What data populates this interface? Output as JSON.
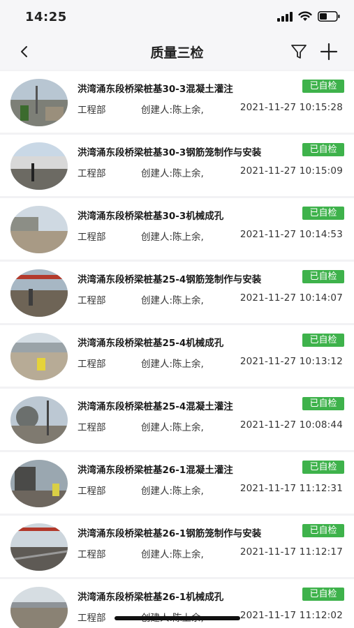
{
  "status": {
    "time": "14:25"
  },
  "nav": {
    "title": "质量三检",
    "back_icon": "back-chevron-icon",
    "filter_icon": "filter-icon",
    "add_icon": "plus-icon"
  },
  "colors": {
    "badge": "#3eb24b",
    "background": "#f2f2f4"
  },
  "items": [
    {
      "title": "洪湾涌东段桥梁桩基30-3混凝土灌注",
      "status": "已自检",
      "dept": "工程部",
      "creator": "创建人:陈上余,",
      "time": "2021-11-27 10:15:28"
    },
    {
      "title": "洪湾涌东段桥梁桩基30-3钢筋笼制作与安装",
      "status": "已自检",
      "dept": "工程部",
      "creator": "创建人:陈上余,",
      "time": "2021-11-27 10:15:09"
    },
    {
      "title": "洪湾涌东段桥梁桩基30-3机械成孔",
      "status": "已自检",
      "dept": "工程部",
      "creator": "创建人:陈上余,",
      "time": "2021-11-27 10:14:53"
    },
    {
      "title": "洪湾涌东段桥梁桩基25-4钢筋笼制作与安装",
      "status": "已自检",
      "dept": "工程部",
      "creator": "创建人:陈上余,",
      "time": "2021-11-27 10:14:07"
    },
    {
      "title": "洪湾涌东段桥梁桩基25-4机械成孔",
      "status": "已自检",
      "dept": "工程部",
      "creator": "创建人:陈上余,",
      "time": "2021-11-27 10:13:12"
    },
    {
      "title": "洪湾涌东段桥梁桩基25-4混凝土灌注",
      "status": "已自检",
      "dept": "工程部",
      "creator": "创建人:陈上余,",
      "time": "2021-11-27 10:08:44"
    },
    {
      "title": "洪湾涌东段桥梁桩基26-1混凝土灌注",
      "status": "已自检",
      "dept": "工程部",
      "creator": "创建人:陈上余,",
      "time": "2021-11-17 11:12:31"
    },
    {
      "title": "洪湾涌东段桥梁桩基26-1钢筋笼制作与安装",
      "status": "已自检",
      "dept": "工程部",
      "creator": "创建人:陈上余,",
      "time": "2021-11-17 11:12:17"
    },
    {
      "title": "洪湾涌东段桥梁桩基26-1机械成孔",
      "status": "已自检",
      "dept": "工程部",
      "creator": "创建人:陈上余,",
      "time": "2021-11-17 11:12:02"
    }
  ]
}
